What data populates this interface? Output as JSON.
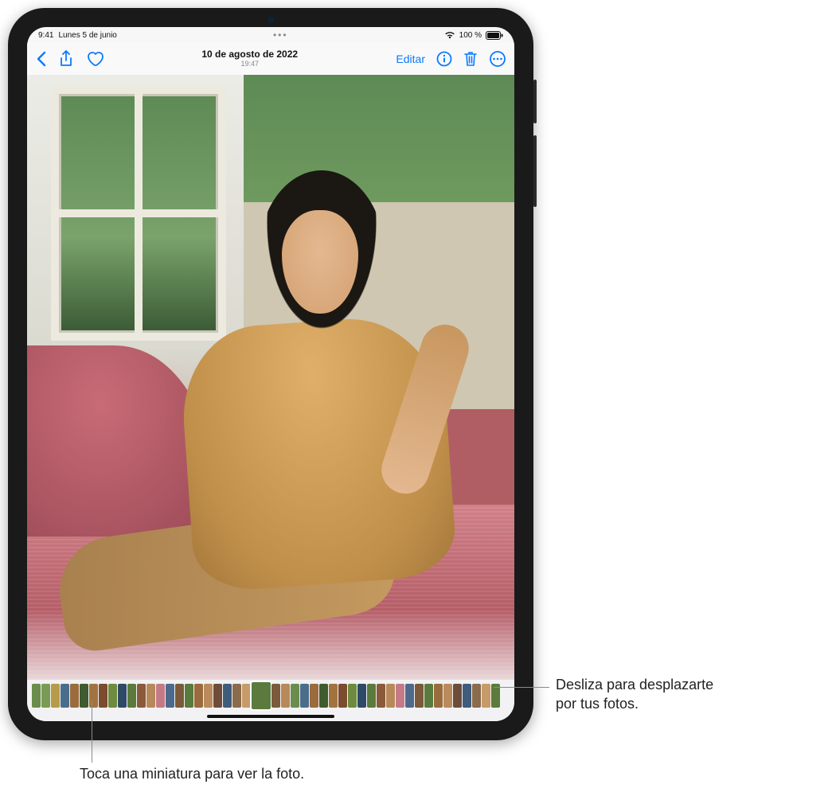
{
  "status": {
    "time": "9:41",
    "date": "Lunes 5 de junio",
    "battery_text": "100 %"
  },
  "toolbar": {
    "title": "10 de agosto de 2022",
    "subtitle": "19:47",
    "edit_label": "Editar"
  },
  "thumbs": {
    "colors": [
      "#6a8c4d",
      "#7a9b55",
      "#b79a4a",
      "#4a6d8c",
      "#9a6b3c",
      "#3e5c2f",
      "#a3733e",
      "#7b4c2e",
      "#6e8b3f",
      "#2f4a66",
      "#5c7a3b",
      "#8a5a3a",
      "#b7885a",
      "#c47a86",
      "#4d6a8c",
      "#7a5a3b",
      "#5a7b3e",
      "#9a6b3c",
      "#b88a5c",
      "#6e4c3a",
      "#3f5c7a",
      "#8a6b4c",
      "#c79a6a",
      "#5a7a3e",
      "#7a5a3b",
      "#b7885a",
      "#6a8c4d",
      "#4a6d8c",
      "#9a6b3c",
      "#3e5c2f",
      "#a3733e",
      "#7b4c2e",
      "#6e8b3f",
      "#2f4a66",
      "#5c7a3b",
      "#8a5a3a",
      "#b7885a",
      "#c47a86",
      "#4d6a8c",
      "#7a5a3b",
      "#5a7b3e",
      "#9a6b3c",
      "#b88a5c",
      "#6e4c3a",
      "#3f5c7a",
      "#8a6b4c",
      "#c79a6a",
      "#5a7a3e"
    ],
    "current_index": 23
  },
  "callouts": {
    "tap": "Toca una miniatura para ver la foto.",
    "swipe_line1": "Desliza para desplazarte",
    "swipe_line2": "por tus fotos."
  }
}
